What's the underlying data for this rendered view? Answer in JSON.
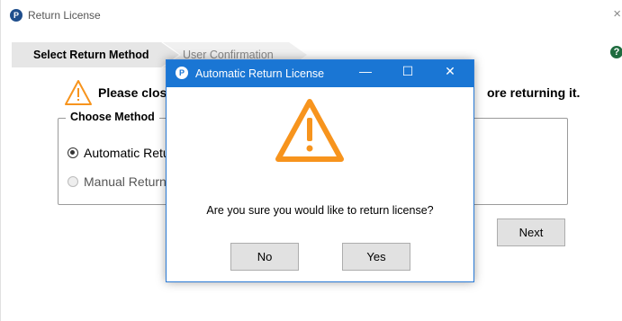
{
  "window": {
    "title": "Return License",
    "close_glyph": "×",
    "icon": "app-logo-icon"
  },
  "tabs": [
    {
      "label": "Select Return Method",
      "active": true
    },
    {
      "label": "User Confirmation",
      "active": false
    }
  ],
  "help_glyph": "?",
  "warning": {
    "text_visible_left": "Please close",
    "text_visible_right": "ore returning it.",
    "icon": "warning-icon",
    "color": "#f7941d"
  },
  "method_group": {
    "legend": "Choose Method",
    "options": [
      {
        "label": "Automatic Retur",
        "selected": true
      },
      {
        "label": "Manual Return",
        "selected": false
      }
    ]
  },
  "next_button": "Next",
  "dialog": {
    "title": "Automatic Return License",
    "title_bar_color": "#1a76d4",
    "minimize_glyph": "—",
    "maximize_glyph": "☐",
    "close_glyph": "✕",
    "message": "Are you sure you would like to return license?",
    "no_label": "No",
    "yes_label": "Yes",
    "icon": "warning-icon"
  }
}
